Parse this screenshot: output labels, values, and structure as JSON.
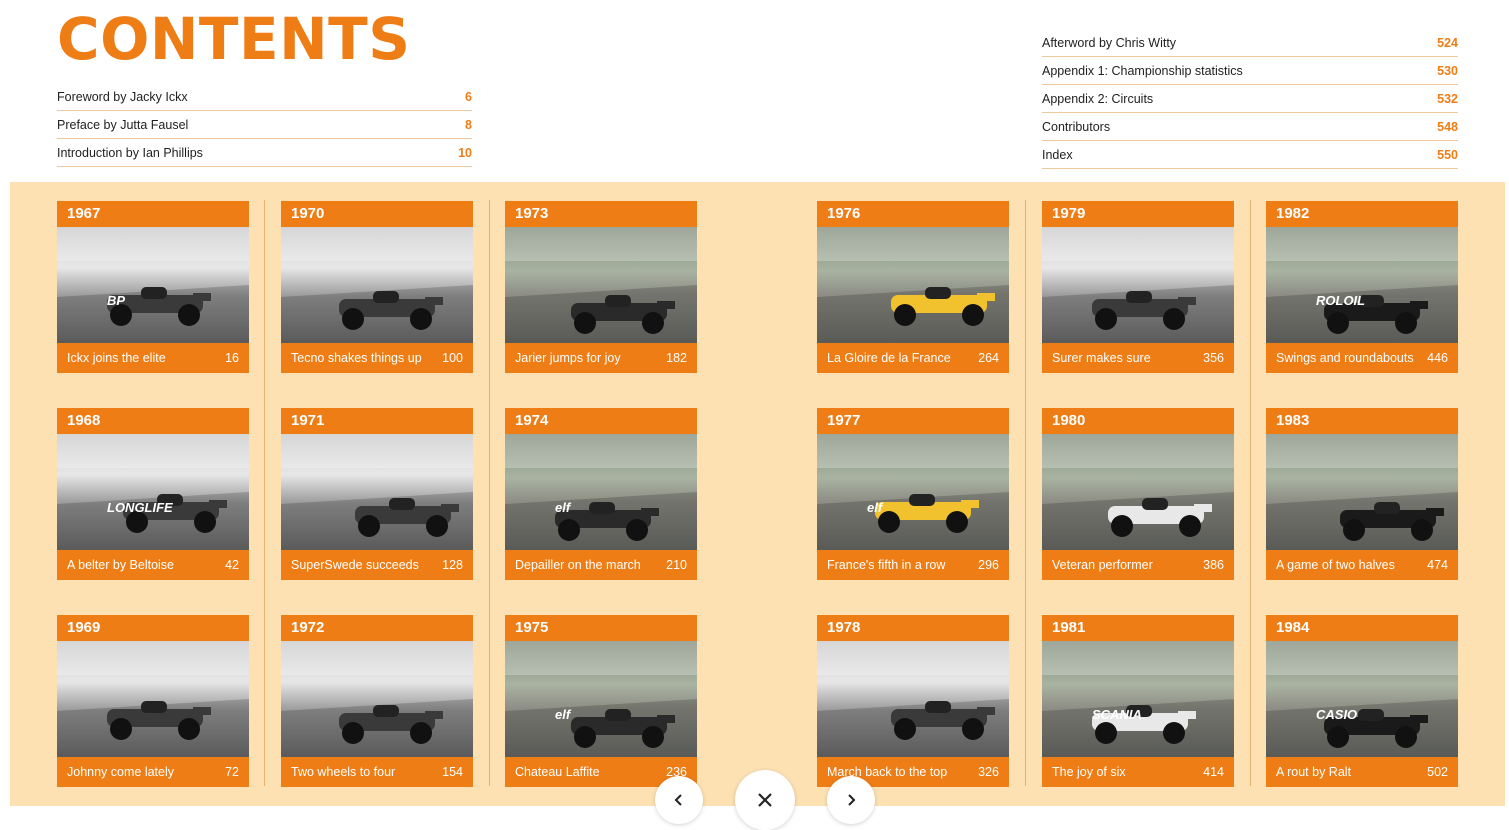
{
  "title": "CONTENTS",
  "toc_left": [
    {
      "label": "Foreword by Jacky Ickx",
      "page": "6"
    },
    {
      "label": "Preface by Jutta Fausel",
      "page": "8"
    },
    {
      "label": "Introduction by Ian Phillips",
      "page": "10"
    }
  ],
  "toc_right": [
    {
      "label": "Afterword by Chris Witty",
      "page": "524"
    },
    {
      "label": "Appendix 1: Championship statistics",
      "page": "530"
    },
    {
      "label": "Appendix 2: Circuits",
      "page": "532"
    },
    {
      "label": "Contributors",
      "page": "548"
    },
    {
      "label": "Index",
      "page": "550"
    }
  ],
  "chapters": [
    {
      "year": "1967",
      "caption": "Ickx joins the elite",
      "page": "16",
      "photo": "bw"
    },
    {
      "year": "1970",
      "caption": "Tecno shakes things up",
      "page": "100",
      "photo": "bw"
    },
    {
      "year": "1973",
      "caption": "Jarier jumps for joy",
      "page": "182",
      "photo": "color"
    },
    {
      "year": "1976",
      "caption": "La Gloire de la France",
      "page": "264",
      "photo": "color"
    },
    {
      "year": "1979",
      "caption": "Surer makes sure",
      "page": "356",
      "photo": "bw"
    },
    {
      "year": "1982",
      "caption": "Swings and roundabouts",
      "page": "446",
      "photo": "color"
    },
    {
      "year": "1968",
      "caption": "A belter by Beltoise",
      "page": "42",
      "photo": "bw"
    },
    {
      "year": "1971",
      "caption": "SuperSwede succeeds",
      "page": "128",
      "photo": "bw"
    },
    {
      "year": "1974",
      "caption": "Depailler on the march",
      "page": "210",
      "photo": "color"
    },
    {
      "year": "1977",
      "caption": "France's fifth in a row",
      "page": "296",
      "photo": "color"
    },
    {
      "year": "1980",
      "caption": "Veteran performer",
      "page": "386",
      "photo": "color"
    },
    {
      "year": "1983",
      "caption": "A game of two halves",
      "page": "474",
      "photo": "color"
    },
    {
      "year": "1969",
      "caption": "Johnny come lately",
      "page": "72",
      "photo": "bw"
    },
    {
      "year": "1972",
      "caption": "Two wheels to four",
      "page": "154",
      "photo": "bw"
    },
    {
      "year": "1975",
      "caption": "Chateau Laffite",
      "page": "236",
      "photo": "color"
    },
    {
      "year": "1978",
      "caption": "March back to the top",
      "page": "326",
      "photo": "bw"
    },
    {
      "year": "1981",
      "caption": "The joy of six",
      "page": "414",
      "photo": "color"
    },
    {
      "year": "1984",
      "caption": "A rout by Ralt",
      "page": "502",
      "photo": "color"
    }
  ],
  "photo_signs": {
    "p1": "BP",
    "p6": "ROLOIL",
    "p7": "LONGLIFE",
    "p9": "elf",
    "p10": "elf",
    "p15": "elf",
    "p17": "SCANIA",
    "p18": "CASIO"
  },
  "nav": {
    "prev_icon": "chevron-left-icon",
    "close_icon": "close-icon",
    "next_icon": "chevron-right-icon"
  },
  "colors": {
    "accent": "#ef7d16",
    "band": "#fde1b3"
  }
}
